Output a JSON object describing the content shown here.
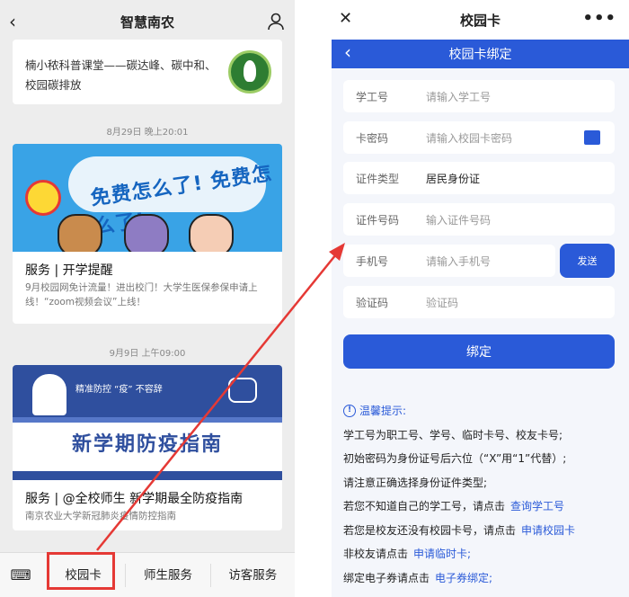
{
  "left": {
    "header_title": "智慧南农",
    "article1_text": "楠小秾科普课堂——碳达峰、碳中和、校园碳排放",
    "timestamp1": "8月29日 晚上20:01",
    "banner1_text": "免费怎么了! 免费怎么了!",
    "article2_title": "服务 | 开学提醒",
    "article2_summary": "9月校园网免计流量！进出校门！大学生医保参保申请上线！“zoom视频会议”上线！",
    "timestamp2": "9月9日 上午09:00",
    "banner2_tag": "精准防控 “疫” 不容辞",
    "banner2_text": "新学期防疫指南",
    "article3_title": "服务 | @全校师生 新学期最全防疫指南",
    "article3_summary": "南京农业大学新冠肺炎疫情防控指南",
    "tabs": [
      "校园卡",
      "师生服务",
      "访客服务"
    ]
  },
  "right": {
    "header_title": "校园卡",
    "bar_title": "校园卡绑定",
    "fields": [
      {
        "label": "学工号",
        "value": "请输入学工号"
      },
      {
        "label": "卡密码",
        "value": "请输入校园卡密码"
      },
      {
        "label": "证件类型",
        "value": "居民身份证"
      },
      {
        "label": "证件号码",
        "value": "输入证件号码"
      },
      {
        "label": "手机号",
        "value": "请输入手机号"
      },
      {
        "label": "验证码",
        "value": "验证码"
      }
    ],
    "send_label": "发送",
    "bind_label": "绑定",
    "tips_title": "温馨提示:",
    "tips": [
      {
        "text": "学工号为职工号、学号、临时卡号、校友卡号;",
        "link": ""
      },
      {
        "text": "初始密码为身份证号后六位（“X”用“1”代替）;",
        "link": ""
      },
      {
        "text": "请注意正确选择身份证件类型;",
        "link": ""
      },
      {
        "text": "若您不知道自己的学工号，请点击",
        "link": "查询学工号"
      },
      {
        "text": "若您是校友还没有校园卡号，请点击",
        "link": "申请校园卡"
      },
      {
        "text": "非校友请点击",
        "link": "申请临时卡;"
      },
      {
        "text": "绑定电子券请点击",
        "link": "电子券绑定;"
      }
    ]
  },
  "colors": {
    "accent": "#2a5ad8",
    "highlight": "#e53935"
  }
}
